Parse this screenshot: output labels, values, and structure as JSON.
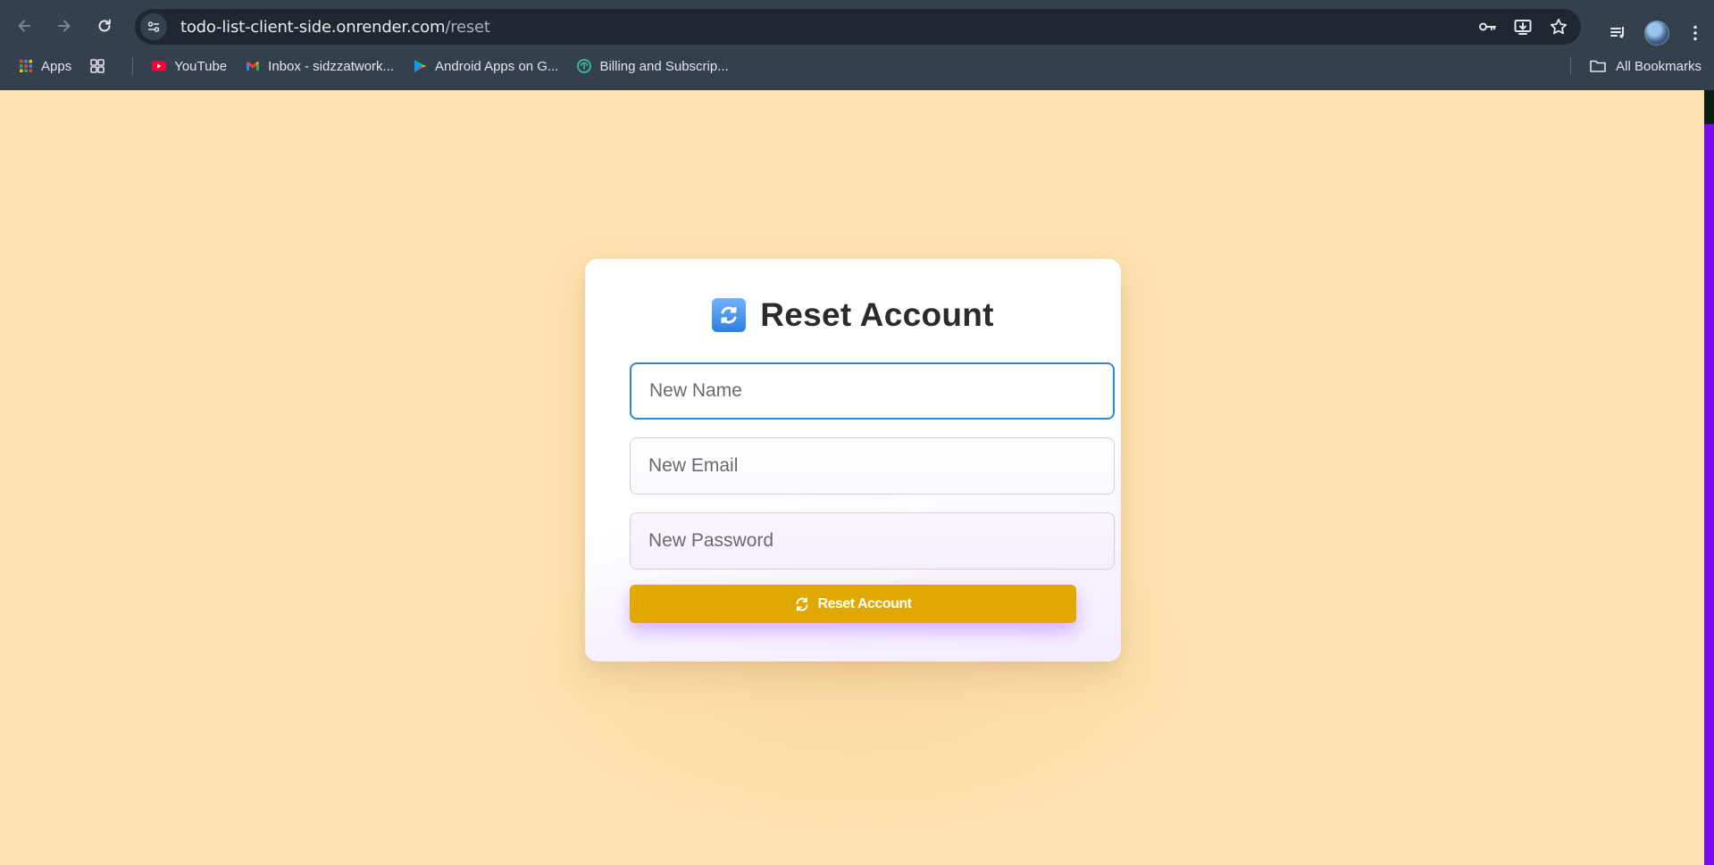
{
  "browser": {
    "url_host": "todo-list-client-side.onrender.com",
    "url_path": "/reset",
    "bookmarks": [
      {
        "label": "Apps",
        "icon": "apps-grid-icon"
      },
      {
        "label": "YouTube",
        "icon": "youtube-icon"
      },
      {
        "label": "Inbox - sidzzatwork...",
        "icon": "gmail-icon"
      },
      {
        "label": "Android Apps on G...",
        "icon": "google-play-icon"
      },
      {
        "label": "Billing and Subscrip...",
        "icon": "openai-icon"
      }
    ],
    "all_bookmarks_label": "All Bookmarks"
  },
  "reset_form": {
    "title": "Reset Account",
    "title_icon": "counterclockwise-arrows-emoji",
    "name_placeholder": "New Name",
    "email_placeholder": "New Email",
    "password_placeholder": "New Password",
    "submit_label": "Reset Account",
    "submit_icon": "refresh-icon"
  },
  "colors": {
    "page_background": "#fde3b0",
    "button": "#e0a800",
    "focus_border": "#2f86d8",
    "scrollbar": "#7a0cf0"
  }
}
